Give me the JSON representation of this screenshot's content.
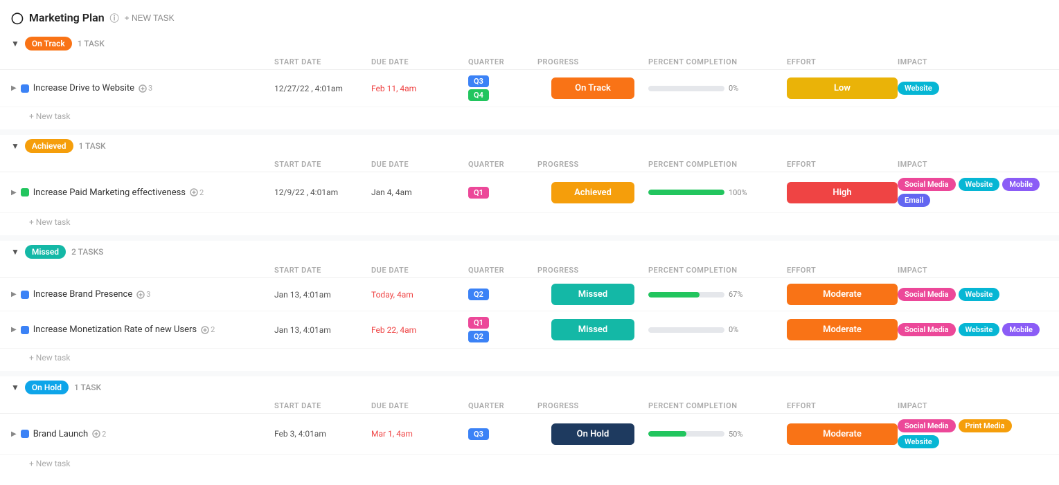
{
  "header": {
    "title": "Marketing Plan",
    "new_task_label": "+ NEW TASK"
  },
  "columns": {
    "task": "",
    "start_date": "START DATE",
    "due_date": "DUE DATE",
    "quarter": "QUARTER",
    "progress": "PROGRESS",
    "percent_completion": "PERCENT COMPLETION",
    "effort": "EFFORT",
    "impact": "IMPACT"
  },
  "sections": [
    {
      "id": "on-track",
      "status": "On Track",
      "badge_class": "badge-on-track",
      "task_count": "1 TASK",
      "tasks": [
        {
          "name": "Increase Drive to Website",
          "subtask_count": "3",
          "color_class": "dot-blue",
          "start_date": "12/27/22 , 4:01am",
          "due_date": "Feb 11, 4am",
          "due_date_class": "date-red",
          "quarters": [
            {
              "label": "Q3",
              "class": "q-blue"
            },
            {
              "label": "Q4",
              "class": "q-green"
            }
          ],
          "progress": "On Track",
          "progress_class": "prog-on-track",
          "percent": 0,
          "effort": "Low",
          "effort_class": "effort-low",
          "impact_tags": [
            {
              "label": "Website",
              "class": "tag-website"
            }
          ]
        }
      ]
    },
    {
      "id": "achieved",
      "status": "Achieved",
      "badge_class": "badge-achieved",
      "task_count": "1 TASK",
      "tasks": [
        {
          "name": "Increase Paid Marketing effectiveness",
          "subtask_count": "2",
          "color_class": "dot-green",
          "start_date": "12/9/22 , 4:01am",
          "due_date": "Jan 4, 4am",
          "due_date_class": "date-text",
          "quarters": [
            {
              "label": "Q1",
              "class": "q-pink"
            }
          ],
          "progress": "Achieved",
          "progress_class": "prog-achieved",
          "percent": 100,
          "effort": "High",
          "effort_class": "effort-high",
          "impact_tags": [
            {
              "label": "Social Media",
              "class": "tag-social"
            },
            {
              "label": "Website",
              "class": "tag-website"
            },
            {
              "label": "Mobile",
              "class": "tag-mobile"
            },
            {
              "label": "Email",
              "class": "tag-email"
            }
          ]
        }
      ]
    },
    {
      "id": "missed",
      "status": "Missed",
      "badge_class": "badge-missed",
      "task_count": "2 TASKS",
      "tasks": [
        {
          "name": "Increase Brand Presence",
          "subtask_count": "3",
          "color_class": "dot-blue",
          "start_date": "Jan 13, 4:01am",
          "due_date": "Today, 4am",
          "due_date_class": "date-today",
          "quarters": [
            {
              "label": "Q2",
              "class": "q-blue"
            }
          ],
          "progress": "Missed",
          "progress_class": "prog-missed",
          "percent": 67,
          "effort": "Moderate",
          "effort_class": "effort-moderate",
          "impact_tags": [
            {
              "label": "Social Media",
              "class": "tag-social"
            },
            {
              "label": "Website",
              "class": "tag-website"
            }
          ]
        },
        {
          "name": "Increase Monetization Rate of new Users",
          "subtask_count": "2",
          "color_class": "dot-blue",
          "start_date": "Jan 13, 4:01am",
          "due_date": "Feb 22, 4am",
          "due_date_class": "date-red",
          "quarters": [
            {
              "label": "Q1",
              "class": "q-pink"
            },
            {
              "label": "Q2",
              "class": "q-blue"
            }
          ],
          "progress": "Missed",
          "progress_class": "prog-missed",
          "percent": 0,
          "effort": "Moderate",
          "effort_class": "effort-moderate",
          "impact_tags": [
            {
              "label": "Social Media",
              "class": "tag-social"
            },
            {
              "label": "Website",
              "class": "tag-website"
            },
            {
              "label": "Mobile",
              "class": "tag-mobile"
            }
          ]
        }
      ]
    },
    {
      "id": "on-hold",
      "status": "On Hold",
      "badge_class": "badge-on-hold",
      "task_count": "1 TASK",
      "tasks": [
        {
          "name": "Brand Launch",
          "subtask_count": "2",
          "color_class": "dot-blue",
          "start_date": "Feb 3, 4:01am",
          "due_date": "Mar 1, 4am",
          "due_date_class": "date-red",
          "quarters": [
            {
              "label": "Q3",
              "class": "q-blue"
            }
          ],
          "progress": "On Hold",
          "progress_class": "prog-on-hold",
          "percent": 50,
          "effort": "Moderate",
          "effort_class": "effort-moderate",
          "impact_tags": [
            {
              "label": "Social Media",
              "class": "tag-social"
            },
            {
              "label": "Print Media",
              "class": "tag-print"
            },
            {
              "label": "Website",
              "class": "tag-website"
            }
          ]
        }
      ]
    }
  ],
  "new_task_label": "+ New task"
}
